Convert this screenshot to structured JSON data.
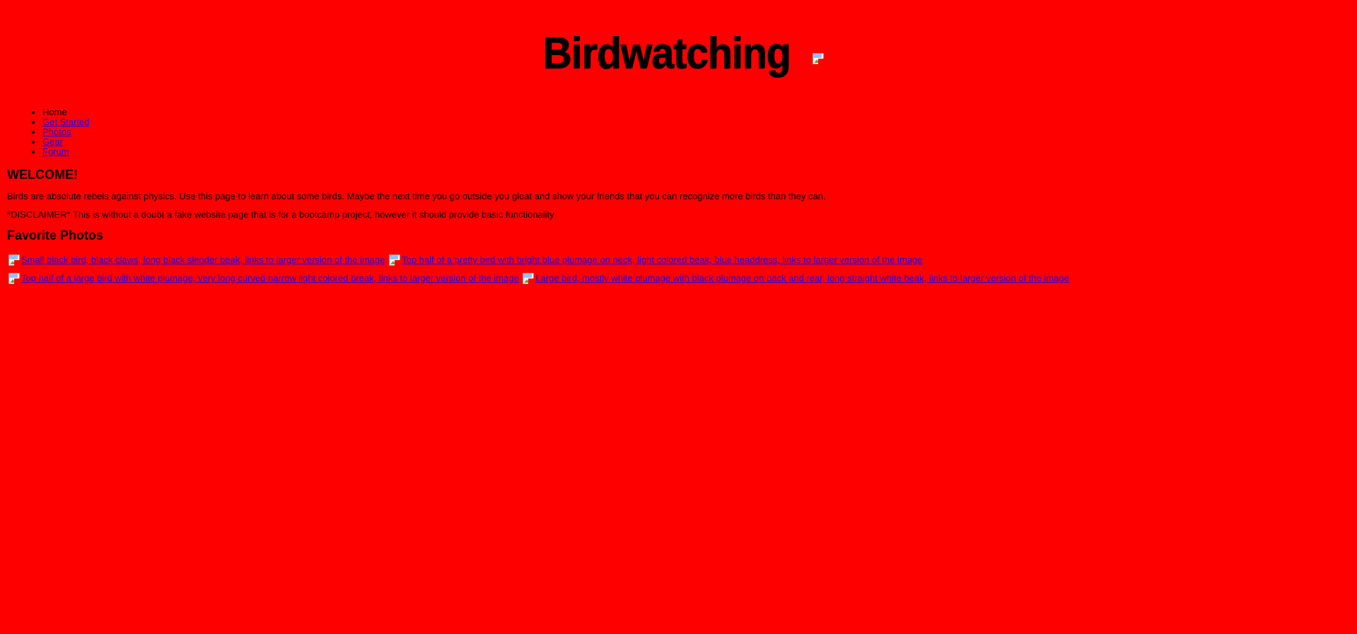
{
  "header": {
    "title": "Birdwatching",
    "logo_icon": "broken-image-icon"
  },
  "nav": {
    "items": [
      {
        "label": "Home",
        "is_link": false
      },
      {
        "label": "Get Started",
        "is_link": true
      },
      {
        "label": "Photos",
        "is_link": true
      },
      {
        "label": "Gear",
        "is_link": true
      },
      {
        "label": "Forum",
        "is_link": true
      }
    ]
  },
  "welcome": {
    "heading": "WELCOME!",
    "intro": "Birds are absolute rebels against physics. Use this page to learn about some birds. Maybe the next time you go outside you gloat and show your friends that you can recognize more birds than they can.",
    "disclaimer": "*DISCLAIMER* This is without a doubt a fake website page that is for a bootcamp project, however it should provide basic functionality"
  },
  "favorites": {
    "heading": "Favorite Photos",
    "photos": [
      {
        "alt": "Small black bird, black claws, long black slender beak, links to larger version of the image"
      },
      {
        "alt": "Top half of a pretty bird with bright blue plumage on neck, light colored beak, blue headdress, links to larger version of the image"
      },
      {
        "alt": "Top half of a large bird with white plumage, very long curved narrow light colored break, links to larger version of the image"
      },
      {
        "alt": "Large bird, mostly white plumage with black plumage on back and rear, long straight white beak, links to larger version of the image"
      }
    ]
  },
  "colors": {
    "page_background": "#ff0000",
    "link": "#1a00ee",
    "text": "#000000"
  }
}
